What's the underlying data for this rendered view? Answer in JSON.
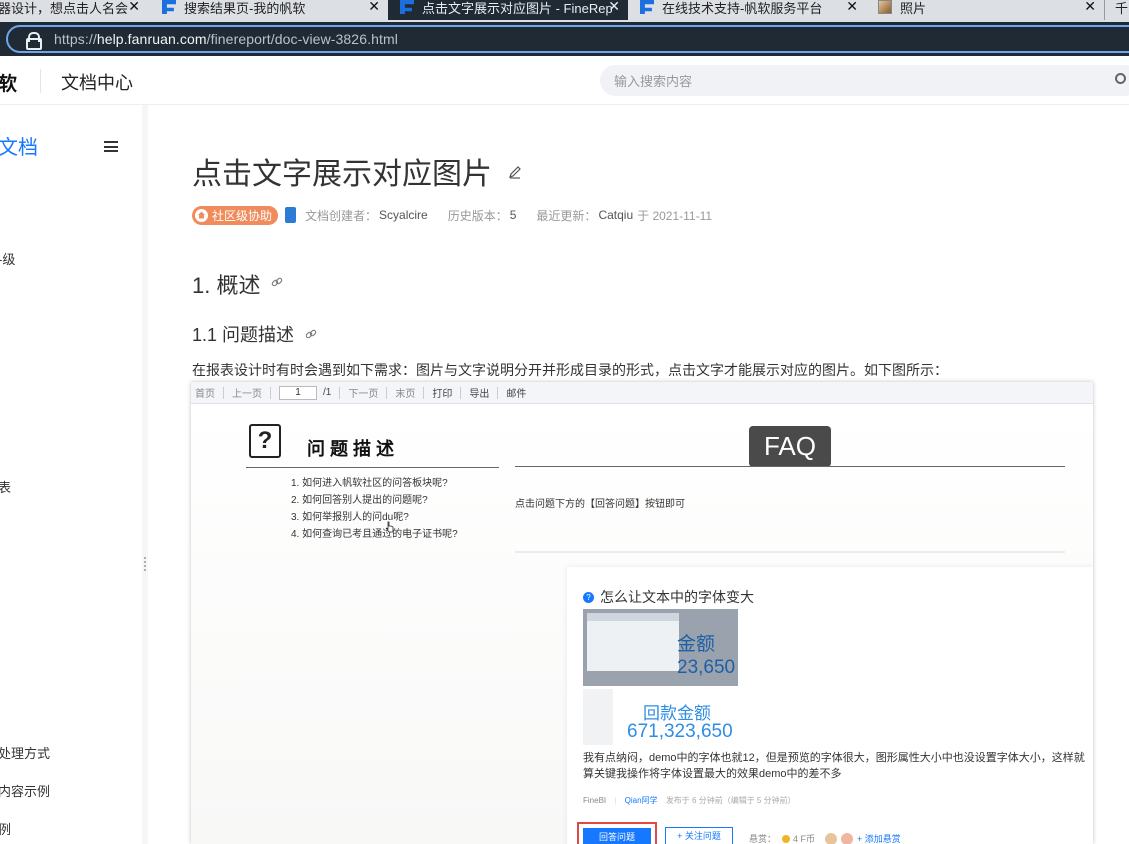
{
  "browser": {
    "tabs": [
      {
        "label": "器设计，想点击人名会",
        "icon": "none",
        "active": false
      },
      {
        "label": "搜索结果页-我的帆软",
        "icon": "f-icon",
        "active": false
      },
      {
        "label": "点击文字展示对应图片 - FineRep",
        "icon": "f-icon",
        "active": true
      },
      {
        "label": "在线技术支持-帆软服务平台",
        "icon": "f-icon",
        "active": false
      },
      {
        "label": "照片",
        "icon": "photo-icon",
        "active": false
      },
      {
        "label": "千",
        "icon": "none",
        "active": false
      }
    ],
    "close_glyph": "✕",
    "url_prefix": "https://",
    "url_host": "help.fanruan.com",
    "url_path": "/finereport/doc-view-3826.html"
  },
  "header": {
    "brand": "软",
    "doc_center": "文档中心",
    "search_placeholder": "输入搜索内容"
  },
  "sidebar": {
    "title": "文档",
    "items": [
      "-级",
      "表",
      "处理方式",
      "内容示例",
      "例"
    ]
  },
  "article": {
    "title": "点击文字展示对应图片",
    "badge": "社区级协助",
    "creator_label": "文档创建者：",
    "creator": "Scyalcire",
    "history_label": "历史版本：",
    "history": "5",
    "updated_label": "最近更新：",
    "updated_by": "Catqiu",
    "updated_on": "于 2021-11-11",
    "h1": "1. 概述",
    "h2": "1.1 问题描述",
    "para": "在报表设计时有时会遇到如下需求：图片与文字说明分开并形成目录的形式，点击文字才能展示对应的图片。如下图所示："
  },
  "screenshot": {
    "toolbar": {
      "first": "首页",
      "prev": "上一页",
      "page": "1",
      "total": "/1",
      "next": "下一页",
      "last": "末页",
      "print": "打印",
      "export": "导出",
      "mail": "邮件"
    },
    "question_icon": "?",
    "question_title": "问题描述",
    "questions": [
      "1. 如何进入帆软社区的问答板块呢?",
      "2. 如何回答别人提出的问题呢?",
      "3. 如何举报别人的问du呢?",
      "4. 如何查询已考且通过的电子证书呢?"
    ],
    "faq_label": "FAQ",
    "faq_answer": "点击问题下方的【回答问题】按钮即可",
    "qa": {
      "title": "怎么让文本中的字体变大",
      "img1_text": "金额\n23,650",
      "img2_title": "回款金额",
      "img2_value": "671,323,650",
      "body": "我有点纳闷，demo中的字体也就12，但是预览的字体很大，图形属性大小中也没设置字体大小，这样就算关键我操作将字体设置最大的效果demo中的差不多",
      "tag": "FineBI",
      "user": "Qian阿学",
      "time": "发布于 6 分钟前（编辑于 5 分钟前）",
      "answer_button": "回答问题",
      "follow_button": "+ 关注问题",
      "reward_label": "悬赏：",
      "reward_value": "4 F币",
      "add_reward": "+ 添加悬赏"
    }
  },
  "colors": {
    "accent": "#1677ff",
    "badge": "#f08b5c",
    "browser_chrome": "#1f2a35"
  }
}
